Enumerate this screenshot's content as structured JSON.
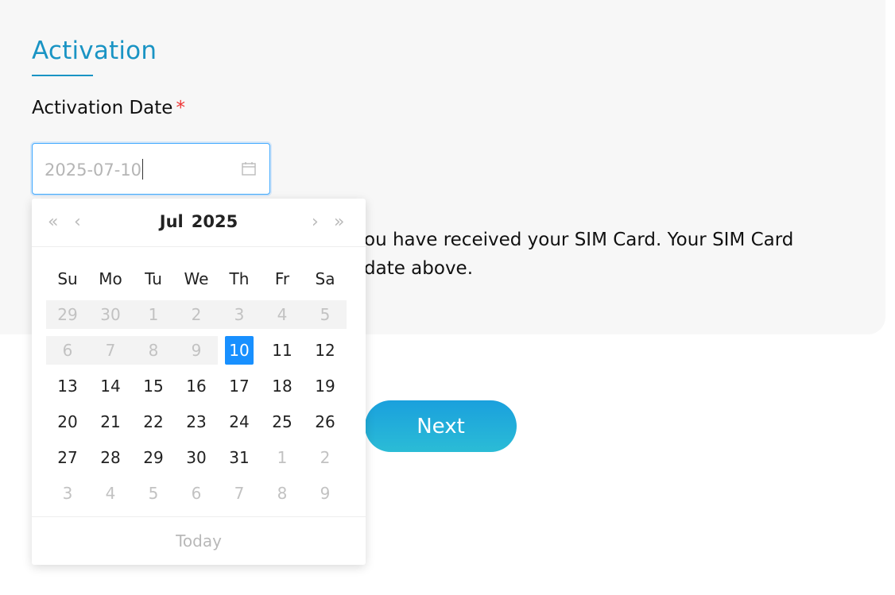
{
  "section": {
    "title": "Activation"
  },
  "field": {
    "label": "Activation Date",
    "required_mark": "*",
    "value": "2025-07-10"
  },
  "description": {
    "line1": "ou have received your SIM Card. Your SIM Card",
    "line2": "date above."
  },
  "next_button": {
    "label": "Next"
  },
  "datepicker": {
    "month": "Jul",
    "year": "2025",
    "nav": {
      "prev_year": "«",
      "prev_month": "‹",
      "next_month": "›",
      "next_year": "»"
    },
    "weekdays": [
      "Su",
      "Mo",
      "Tu",
      "We",
      "Th",
      "Fr",
      "Sa"
    ],
    "weeks": [
      [
        "29",
        "30",
        "1",
        "2",
        "3",
        "4",
        "5"
      ],
      [
        "6",
        "7",
        "8",
        "9",
        "10",
        "11",
        "12"
      ],
      [
        "13",
        "14",
        "15",
        "16",
        "17",
        "18",
        "19"
      ],
      [
        "20",
        "21",
        "22",
        "23",
        "24",
        "25",
        "26"
      ],
      [
        "27",
        "28",
        "29",
        "30",
        "31",
        "1",
        "2"
      ],
      [
        "3",
        "4",
        "5",
        "6",
        "7",
        "8",
        "9"
      ]
    ],
    "selected_day": "10",
    "today_label": "Today"
  },
  "colors": {
    "accent": "#1a94c4",
    "selected": "#1890ff",
    "required": "#e33333"
  }
}
